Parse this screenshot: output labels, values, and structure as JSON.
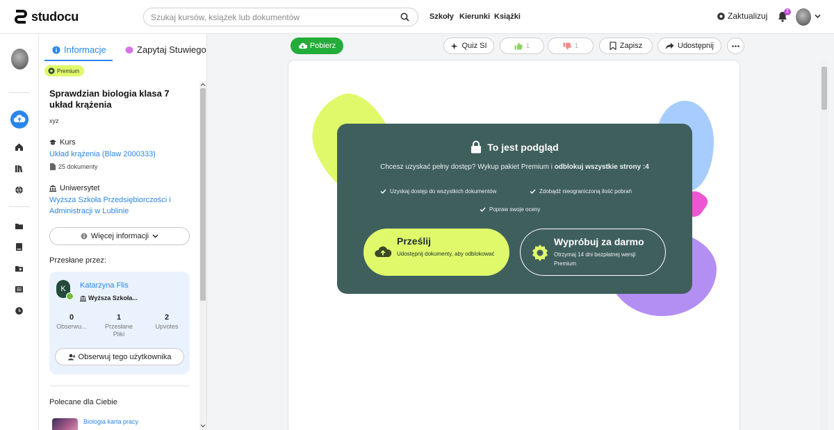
{
  "header": {
    "logo_text": "studocu",
    "search_placeholder": "Szukaj kursów, książek lub dokumentów",
    "nav": [
      "Szkoły",
      "Kierunki",
      "Książki"
    ],
    "upgrade_label": "Zaktualizuj",
    "notification_count": "2"
  },
  "panel": {
    "tab_info": "Informacje",
    "tab_ai": "Zapytaj Stuwiego",
    "premium_label": "Premium",
    "doc_title": "Sprawdzian biologia klasa 7 układ krążenia",
    "doc_desc": "xyz",
    "course_label": "Kurs",
    "course_name": "Układ krążenia (Blaw 2000333)",
    "course_docs": "25 dokumenty",
    "university_label": "Uniwersytet",
    "university_name": "Wyższa Szkoła Przedsiębiorczości i Administracji w Lublinie",
    "more_info": "Więcej informacji",
    "uploaded_by": "Przesłane przez:",
    "user": {
      "initial": "K",
      "name": "Katarzyna Flis",
      "school": "Wyższa Szkoła...",
      "stats": [
        {
          "value": "0",
          "label": "Obserwu..."
        },
        {
          "value": "1",
          "label": "Przesłane Pliki"
        },
        {
          "value": "2",
          "label": "Upvotes"
        }
      ],
      "follow_label": "Obserwuj tego użytkownika"
    },
    "recommended_label": "Polecane dla Ciebie",
    "recommended_first": "Biologia karta pracy"
  },
  "toolbar": {
    "download": "Pobierz",
    "quiz": "Quiz SI",
    "upvotes": "1",
    "downvotes": "1",
    "save": "Zapisz",
    "share": "Udostępnij"
  },
  "preview": {
    "title": "To jest podgląd",
    "subtitle_start": "Chcesz uzyskać pełny dostęp? Wykup pakiet Premium i ",
    "subtitle_bold": "odblokuj wszystkie strony :4",
    "features": [
      "Uzyskaj dostęp do wszystkich dokumentów",
      "Zdobądź nieograniczoną ilość pobrań",
      "Popraw swoje oceny"
    ],
    "upload_title": "Prześlij",
    "upload_desc": "Udostępnij dokumenty, aby odblokować",
    "trial_title": "Wypróbuj za darmo",
    "trial_desc": "Otrzymaj 14 dni bezpłatnej wersji Premium"
  },
  "colors": {
    "accent_blue": "#2a86e8",
    "download_green": "#22ad3a",
    "lime": "#e0f96b",
    "card_teal": "#3f5f5d"
  }
}
